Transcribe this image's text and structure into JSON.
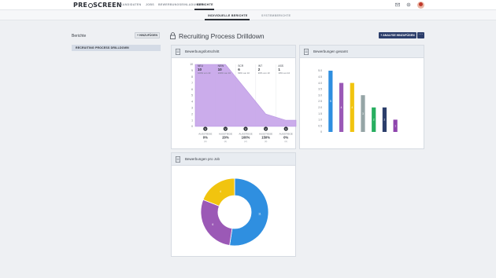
{
  "nav": {
    "logo_left": "PRE",
    "logo_right": "SCREEN",
    "items": [
      "KANDIDATEN",
      "JOBS",
      "BEWERBUNGSEINLADUNGEN",
      "BERICHTE"
    ],
    "active_index": 3
  },
  "subtabs": {
    "items": [
      "INDIVIDUELLE BERICHTE",
      "SYSTEMBERICHTE"
    ],
    "active_index": 0
  },
  "sidebar": {
    "title": "Berichte",
    "add_label": "+ HINZUFÜGEN",
    "reports": [
      {
        "label": "RECRUITING PROCESS DRILLDOWN",
        "count": "1"
      }
    ]
  },
  "header": {
    "title": "Recruiting Process Drilldown",
    "analysis_button": "+ ANALYSE HINZUFÜGEN",
    "more_button": "···"
  },
  "cards": {
    "progress": {
      "title": "Bewerbungsfortschritt"
    },
    "total": {
      "title": "Bewerbungen gesamt"
    },
    "per_job": {
      "title": "Bewerbungen pro Job"
    }
  },
  "chart_data": [
    {
      "type": "area",
      "title": "Bewerbungsfortschritt",
      "ylim": [
        0,
        10
      ],
      "y_ticks": [
        "10",
        "9",
        "8",
        "7",
        "6",
        "5",
        "4",
        "3",
        "2",
        "1",
        "0"
      ],
      "stages": [
        {
          "abbr": "NEU",
          "value": 10,
          "sub": "100% von 10",
          "dropout_label": "AUSSTIEGE",
          "dropout_pct": "0%",
          "dropout_count": "(0)"
        },
        {
          "abbr": "NEW",
          "value": 10,
          "sub": "100% von 10",
          "dropout_label": "AUSSTIEGE",
          "dropout_pct": "20%",
          "dropout_count": "(2)"
        },
        {
          "abbr": "SCR",
          "value": 6,
          "sub": "60% von 10",
          "dropout_label": "AUSSTIEGE",
          "dropout_pct": "100%",
          "dropout_count": "(2)"
        },
        {
          "abbr": "INT",
          "value": 2,
          "sub": "20% von 10",
          "dropout_label": "AUSSTIEGE",
          "dropout_pct": "150%",
          "dropout_count": "(3)"
        },
        {
          "abbr": "ASS",
          "value": 1,
          "sub": "10% von 10",
          "dropout_label": "AUSSTIEGE",
          "dropout_pct": "0%",
          "dropout_count": "(0)"
        }
      ],
      "fill_color": "#c9a8ea",
      "line_color": "#b48fe0"
    },
    {
      "type": "bar",
      "title": "Bewerbungen gesamt",
      "ylim": [
        0,
        5.0
      ],
      "y_ticks": [
        "5.0",
        "4.5",
        "4.0",
        "3.5",
        "3.0",
        "2.5",
        "2.0",
        "1.5",
        "1.0",
        "0.5",
        "0"
      ],
      "values": [
        5,
        4,
        4,
        3,
        2,
        2,
        1
      ],
      "labels": [
        "5",
        "4",
        "4",
        "3",
        "2",
        "2",
        "1"
      ],
      "colors": [
        "#2f8fe0",
        "#9b59b6",
        "#f1c40f",
        "#95a5a6",
        "#27ae60",
        "#2c3e6b",
        "#8e44ad"
      ]
    },
    {
      "type": "pie",
      "title": "Bewerbungen pro Job",
      "values": [
        11,
        6,
        4
      ],
      "labels": [
        "11",
        "6",
        "4"
      ],
      "colors": [
        "#2f8fe0",
        "#9b59b6",
        "#f1c40f"
      ]
    }
  ]
}
